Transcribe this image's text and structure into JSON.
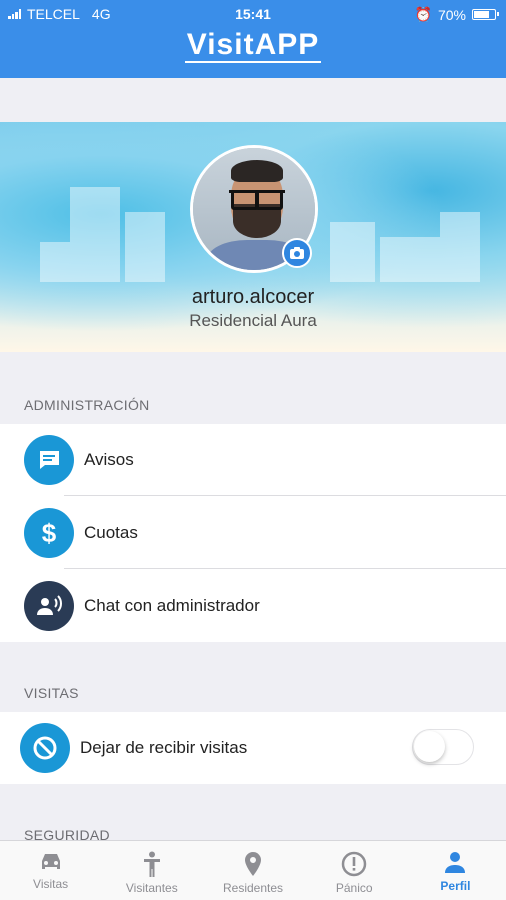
{
  "status_bar": {
    "carrier": "TELCEL",
    "network": "4G",
    "time": "15:41",
    "battery": "70%",
    "battery_level": 0.7
  },
  "app": {
    "brand": "VisitAPP"
  },
  "profile": {
    "username": "arturo.alcocer",
    "community": "Residencial Aura",
    "avatar_icon": "person-photo",
    "camera_icon": "camera-icon"
  },
  "sections": {
    "admin": {
      "title": "ADMINISTRACIÓN",
      "items": [
        {
          "label": "Avisos",
          "icon": "message-icon",
          "color": "#1a97d6"
        },
        {
          "label": "Cuotas",
          "icon": "dollar-icon",
          "color": "#1a97d6"
        },
        {
          "label": "Chat con administrador",
          "icon": "admin-chat-icon",
          "color": "#2a3b55"
        }
      ]
    },
    "visits": {
      "title": "VISITAS",
      "items": [
        {
          "label": "Dejar de recibir visitas",
          "icon": "block-icon",
          "color": "#1a97d6",
          "toggle_on": false
        }
      ]
    },
    "security": {
      "title": "SEGURIDAD"
    }
  },
  "tabs": [
    {
      "label": "Visitas",
      "icon": "car-icon",
      "active": false
    },
    {
      "label": "Visitantes",
      "icon": "person-walk-icon",
      "active": false
    },
    {
      "label": "Residentes",
      "icon": "location-pin-icon",
      "active": false
    },
    {
      "label": "Pánico",
      "icon": "alert-icon",
      "active": false
    },
    {
      "label": "Perfil",
      "icon": "profile-icon",
      "active": true
    }
  ],
  "colors": {
    "header": "#3a8ee9",
    "accent": "#2f86e0",
    "background": "#efeff4"
  }
}
